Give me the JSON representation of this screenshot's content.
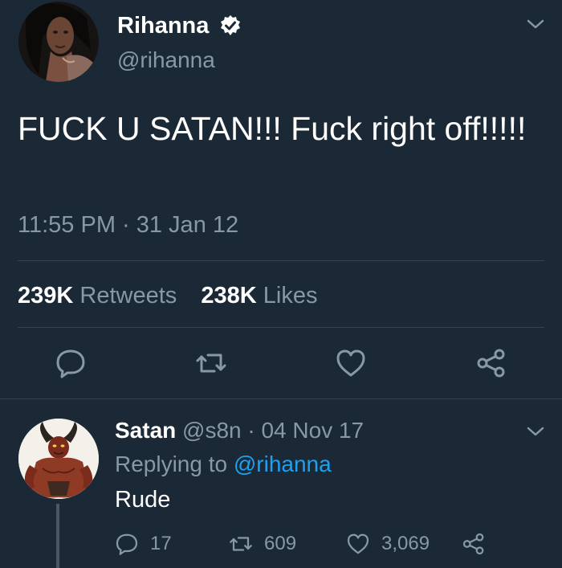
{
  "main_tweet": {
    "display_name": "Rihanna",
    "handle": "@rihanna",
    "text": "FUCK U SATAN!!! Fuck right off!!!!!",
    "timestamp": "11:55 PM · 31 Jan 12",
    "retweets_count": "239K",
    "retweets_label": "Retweets",
    "likes_count": "238K",
    "likes_label": "Likes",
    "icons": [
      "verified-icon",
      "chevron-down-icon",
      "reply-icon",
      "retweet-icon",
      "like-icon",
      "share-icon"
    ]
  },
  "reply": {
    "display_name": "Satan",
    "meta": "@s8n · 04 Nov 17",
    "replying_label": "Replying to",
    "replying_mention": "@rihanna",
    "text": "Rude",
    "reply_count": "17",
    "retweet_count": "609",
    "like_count": "3,069"
  },
  "colors": {
    "background": "#1b2836",
    "secondary_text": "#8899a6",
    "link": "#1da1f2",
    "divider": "#38444d"
  }
}
